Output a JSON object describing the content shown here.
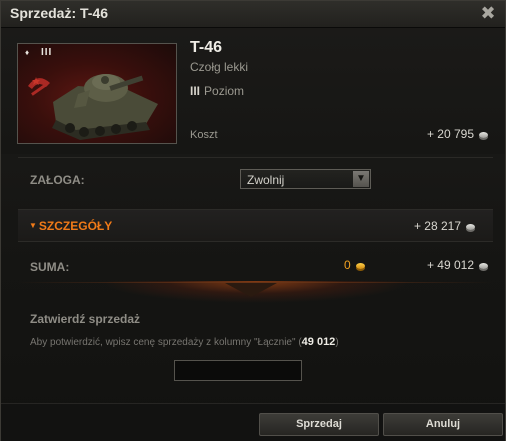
{
  "window": {
    "title": "Sprzedaż: T-46",
    "close_icon": "close-icon"
  },
  "vehicle": {
    "name": "T-46",
    "class": "Czołg lekki",
    "tier_roman": "III",
    "tier_label": "Poziom",
    "badge_tier": "III",
    "badge_marker": "♦",
    "cost_label": "Koszt",
    "cost_value": "+ 20 795"
  },
  "crew": {
    "label": "ZAŁOGA:",
    "selected": "Zwolnij"
  },
  "details": {
    "label": "SZCZEGÓŁY",
    "value": "+ 28 217"
  },
  "sum": {
    "label": "SUMA:",
    "gold": "0",
    "credits": "+ 49 012"
  },
  "confirm": {
    "title": "Zatwierdź sprzedaż",
    "text_before": "Aby potwierdzić, wpisz cenę sprzedaży z kolumny \"Łącznie\" (",
    "amount": "49 012",
    "text_after": ")",
    "input_value": ""
  },
  "buttons": {
    "sell": "Sprzedaj",
    "cancel": "Anuluj"
  },
  "colors": {
    "accent": "#f07a18",
    "gold": "#f0a020",
    "background": "#151513"
  }
}
